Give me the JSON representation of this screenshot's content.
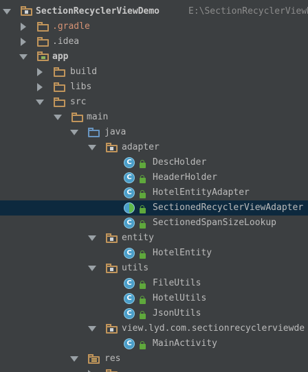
{
  "project": {
    "name": "SectionRecyclerViewDemo",
    "path": "E:\\SectionRecyclerViewDemo"
  },
  "tree": {
    "gradle": ".gradle",
    "idea": ".idea",
    "app": "app",
    "build": "build",
    "libs": "libs",
    "src": "src",
    "main": "main",
    "java": "java",
    "adapter": "adapter",
    "adapter_classes": [
      "DescHolder",
      "HeaderHolder",
      "HotelEntityAdapter",
      "SectionedRecyclerViewAdapter",
      "SectionedSpanSizeLookup"
    ],
    "entity": "entity",
    "entity_classes": [
      "HotelEntity"
    ],
    "utils": "utils",
    "utils_classes": [
      "FileUtils",
      "HotelUtils",
      "JsonUtils"
    ],
    "view_pkg": "view.lyd.com.sectionrecyclerviewde",
    "view_classes": [
      "MainActivity"
    ],
    "res": "res",
    "class_badge": "C"
  },
  "colors": {
    "panel_bg": "#3c3f41",
    "selection_bg": "#0d293e",
    "folder": "#c1955b",
    "source_folder": "#6895c1",
    "class_icon": "#4a9ec9",
    "lock": "#5fa83c"
  }
}
